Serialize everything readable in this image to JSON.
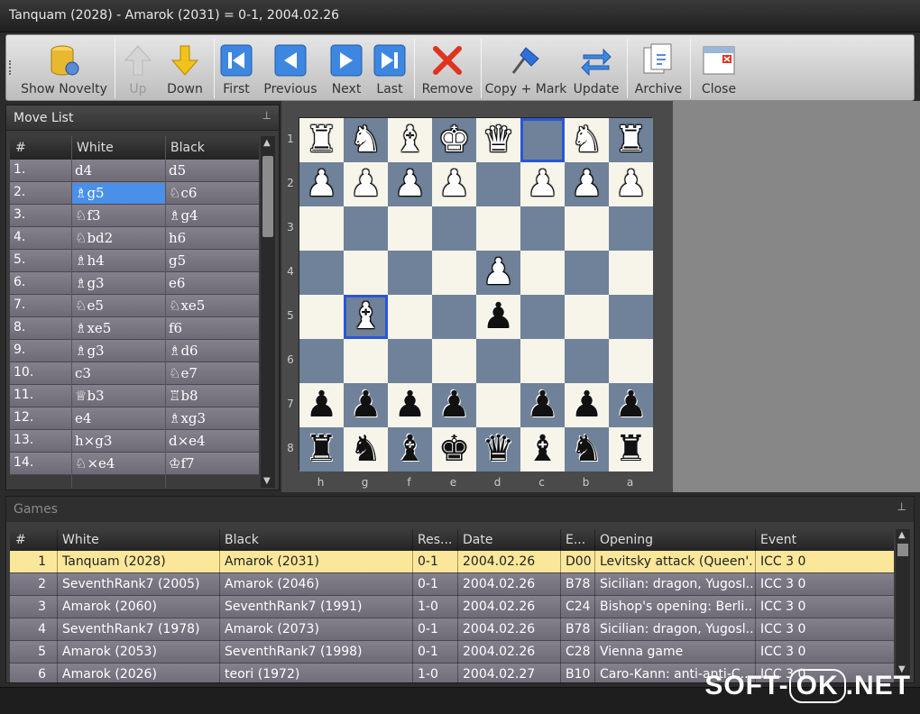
{
  "window": {
    "title": "Tanquam (2028) - Amarok (2031) = 0-1, 2004.02.26"
  },
  "toolbar": {
    "show_novelty": "Show Novelty",
    "up": "Up",
    "down": "Down",
    "first": "First",
    "previous": "Previous",
    "next": "Next",
    "last": "Last",
    "remove": "Remove",
    "copy_mark": "Copy + Mark",
    "update": "Update",
    "archive": "Archive",
    "close": "Close"
  },
  "move_list": {
    "title": "Move List",
    "pin": "⊥",
    "headers": {
      "num": "#",
      "white": "White",
      "black": "Black"
    },
    "rows": [
      {
        "num": "1.",
        "white": "d4",
        "black": "d5"
      },
      {
        "num": "2.",
        "white": "♗g5",
        "black": "♘c6"
      },
      {
        "num": "3.",
        "white": "♘f3",
        "black": "♗g4"
      },
      {
        "num": "4.",
        "white": "♘bd2",
        "black": "h6"
      },
      {
        "num": "5.",
        "white": "♗h4",
        "black": "g5"
      },
      {
        "num": "6.",
        "white": "♗g3",
        "black": "e6"
      },
      {
        "num": "7.",
        "white": "♘e5",
        "black": "♘xe5"
      },
      {
        "num": "8.",
        "white": "♗xe5",
        "black": "f6"
      },
      {
        "num": "9.",
        "white": "♗g3",
        "black": "♗d6"
      },
      {
        "num": "10.",
        "white": "c3",
        "black": "♘e7"
      },
      {
        "num": "11.",
        "white": "♕b3",
        "black": "♖b8"
      },
      {
        "num": "12.",
        "white": "e4",
        "black": "♗xg3"
      },
      {
        "num": "13.",
        "white": "h×g3",
        "black": "d×e4"
      },
      {
        "num": "14.",
        "white": "♘×e4",
        "black": "♔f7"
      }
    ],
    "selected_row": 1
  },
  "board": {
    "ranks": [
      "1",
      "2",
      "3",
      "4",
      "5",
      "6",
      "7",
      "8"
    ],
    "files": [
      "h",
      "g",
      "f",
      "e",
      "d",
      "c",
      "b",
      "a"
    ],
    "rows": [
      [
        "R",
        "N",
        "B",
        "K",
        "Q",
        "",
        "N",
        "R"
      ],
      [
        "P",
        "P",
        "P",
        "P",
        "",
        "P",
        "P",
        "P"
      ],
      [
        "",
        "",
        "",
        "",
        "",
        "",
        "",
        ""
      ],
      [
        "",
        "",
        "",
        "",
        "P",
        "",
        "",
        ""
      ],
      [
        "",
        "B",
        "",
        "",
        "p",
        "",
        "",
        ""
      ],
      [
        "",
        "",
        "",
        "",
        "",
        "",
        "",
        ""
      ],
      [
        "p",
        "p",
        "p",
        "p",
        "",
        "p",
        "p",
        "p"
      ],
      [
        "r",
        "n",
        "b",
        "k",
        "q",
        "b",
        "n",
        "r"
      ]
    ],
    "highlight": [
      [
        0,
        5
      ],
      [
        4,
        1
      ]
    ]
  },
  "games": {
    "title": "Games",
    "pin": "⊥",
    "headers": {
      "num": "#",
      "white": "White",
      "black": "Black",
      "result": "Res...",
      "date": "Date",
      "eco": "E...",
      "opening": "Opening",
      "event": "Event"
    },
    "rows": [
      {
        "num": "1",
        "white": "Tanquam (2028)",
        "black": "Amarok (2031)",
        "result": "0-1",
        "date": "2004.02.26",
        "eco": "D00",
        "opening": "Levitsky attack (Queen'...",
        "event": "ICC 3 0"
      },
      {
        "num": "2",
        "white": "SeventhRank7 (2005)",
        "black": "Amarok (2046)",
        "result": "0-1",
        "date": "2004.02.26",
        "eco": "B78",
        "opening": "Sicilian: dragon, Yugosl...",
        "event": "ICC 3 0"
      },
      {
        "num": "3",
        "white": "Amarok (2060)",
        "black": "SeventhRank7 (1991)",
        "result": "1-0",
        "date": "2004.02.26",
        "eco": "C24",
        "opening": "Bishop's opening: Berli...",
        "event": "ICC 3 0"
      },
      {
        "num": "4",
        "white": "SeventhRank7 (1978)",
        "black": "Amarok (2073)",
        "result": "0-1",
        "date": "2004.02.26",
        "eco": "B78",
        "opening": "Sicilian: dragon, Yugosl...",
        "event": "ICC 3 0"
      },
      {
        "num": "5",
        "white": "Amarok (2053)",
        "black": "SeventhRank7 (1998)",
        "result": "0-1",
        "date": "2004.02.26",
        "eco": "C28",
        "opening": "Vienna game",
        "event": "ICC 3 0"
      },
      {
        "num": "6",
        "white": "Amarok (2026)",
        "black": "teori (1972)",
        "result": "1-0",
        "date": "2004.02.27",
        "eco": "B10",
        "opening": "Caro-Kann: anti-anti-C...",
        "event": "ICC 3 0"
      }
    ],
    "selected_row": 0
  },
  "watermark": {
    "left": "SOFT-",
    "mid": "OK",
    "right": ".NET"
  },
  "colors": {
    "selection_blue": "#4a90e8",
    "selected_game": "#fbe79a",
    "dark_square": "#6f8299",
    "light_square": "#f7f4ea"
  }
}
